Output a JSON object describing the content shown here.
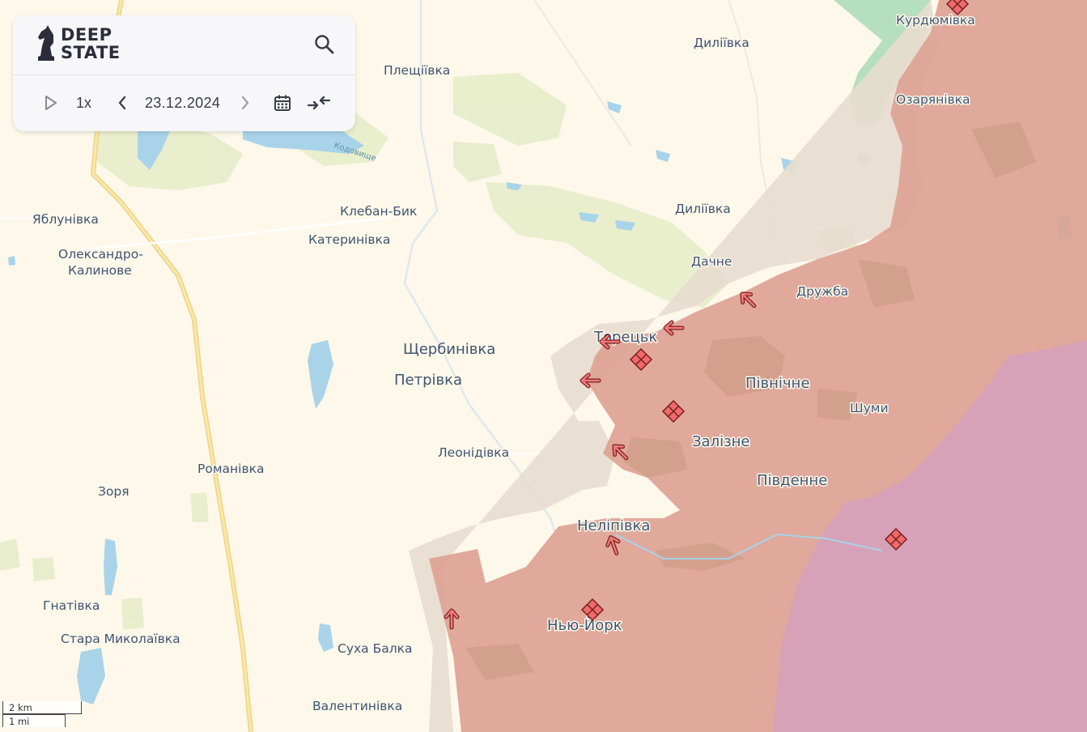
{
  "app": {
    "logo_line1": "DEEP",
    "logo_line2": "STATE"
  },
  "toolbar": {
    "speed": "1x",
    "date": "23.12.2024",
    "icons": [
      "play-icon",
      "chevron-left-icon",
      "chevron-right-icon",
      "calendar-icon",
      "collapse-icon",
      "search-icon"
    ]
  },
  "scale": {
    "km": "2 km",
    "mi": "1 mi"
  },
  "colors": {
    "occupied": "#dda294",
    "contested": "#e7dccf",
    "liberated": "#b5dfbe",
    "crimea_occupied": "#d6a1ba",
    "attack": "#e76a6a",
    "background": "#fdf8ea",
    "label": "#3f5573"
  },
  "places": {
    "kurdiumivka": "Курдюмівка",
    "dyliivka_n": "Диліївка",
    "pleshchiivka": "Плещіївка",
    "ozarianivka": "Озарянівка",
    "kleban_byk": "Клебан-Бик",
    "dyliivka": "Диліївка",
    "yablunivka": "Яблунівка",
    "katerynivka": "Катеринівка",
    "oleksandro_1": "Олександро-",
    "oleksandro_2": "Калинове",
    "dachne": "Дачне",
    "druzhba": "Дружба",
    "toretsk": "Торецьк",
    "shcherbynivka": "Щербинівка",
    "petrivka": "Петрівка",
    "pivnichne": "Північне",
    "shumy": "Шуми",
    "zalizne": "Залізне",
    "leonidivka": "Леонідівка",
    "romanivka": "Романівка",
    "zoria": "Зоря",
    "pivdenne": "Південне",
    "nelipivka": "Неліпівка",
    "hnativka": "Гнатівка",
    "new_york": "Нью-Йорк",
    "stara_mykolaivka": "Стара Миколаївка",
    "sukha_balka": "Суха Балка",
    "valentynivka": "Валентинівка",
    "reservoir_label": "Кодовище"
  },
  "attack_arrows": 8,
  "battle_markers": 6
}
